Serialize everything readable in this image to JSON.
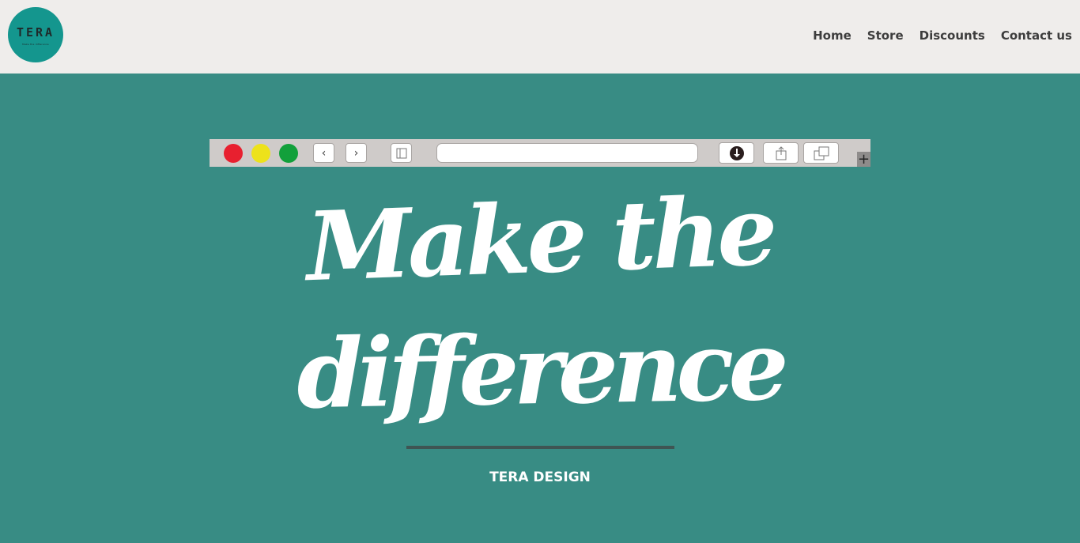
{
  "header": {
    "logo_text": "TERA",
    "logo_tagline": "Make the difference",
    "nav": [
      {
        "label": "Home"
      },
      {
        "label": "Store"
      },
      {
        "label": "Discounts"
      },
      {
        "label": "Contact us"
      }
    ]
  },
  "browser_mock": {
    "back_glyph": "‹",
    "forward_glyph": "›",
    "plus_glyph": "+",
    "dot_colors": [
      "#e8202f",
      "#ede21b",
      "#12a03b"
    ]
  },
  "hero": {
    "headline_line1": "Make the",
    "headline_line2": "difference",
    "tagline": "TERA DESIGN"
  }
}
